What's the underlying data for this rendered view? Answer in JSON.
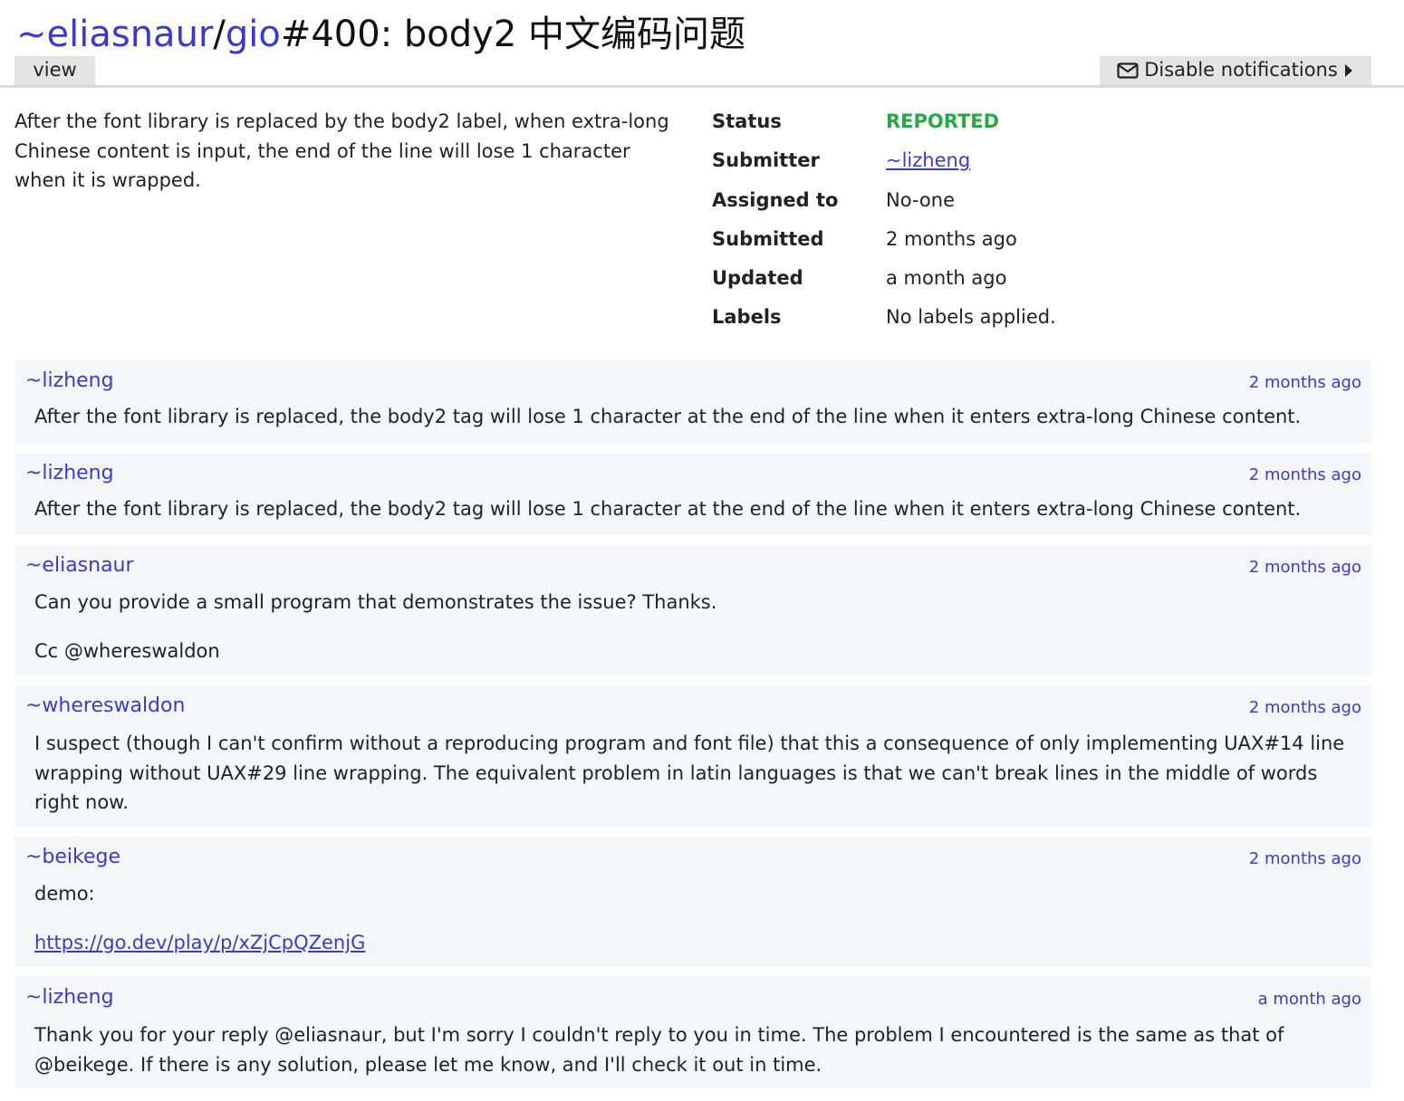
{
  "header": {
    "owner": "~eliasnaur",
    "separator": "/",
    "repo": "gio",
    "issue_title": "#400: body2 中文编码问题",
    "tab_view": "view",
    "notify_label": "Disable notifications",
    "notify_icon": "envelope-icon",
    "notify_caret": "caret-right-icon"
  },
  "summary": "After the font library is replaced by the body2 label, when extra-long Chinese content is input, the end of the line will lose 1 character when it is wrapped.",
  "meta": {
    "status_key": "Status",
    "status_val": "REPORTED",
    "status_color": "#27a844",
    "submitter_key": "Submitter",
    "submitter_val": "~lizheng",
    "assigned_key": "Assigned to",
    "assigned_val": "No-one",
    "submitted_key": "Submitted",
    "submitted_val": "2 months ago",
    "updated_key": "Updated",
    "updated_val": "a month ago",
    "labels_key": "Labels",
    "labels_val": "No labels applied."
  },
  "comments": [
    {
      "author": "~lizheng",
      "time": "2 months ago",
      "text": "After the font library is replaced, the body2 tag will lose 1 character at the end of the line when it enters extra-long Chinese content."
    },
    {
      "author": "~lizheng",
      "time": "2 months ago",
      "text": "After the font library is replaced, the body2 tag will lose 1 character at the end of the line when it enters extra-long Chinese content."
    },
    {
      "author": "~eliasnaur",
      "time": "2 months ago",
      "text": "Can you provide a small program that demonstrates the issue? Thanks.",
      "text2": "Cc @whereswaldon"
    },
    {
      "author": "~whereswaldon",
      "time": "2 months ago",
      "text": "I suspect (though I can't confirm without a reproducing program and font file) that this a consequence of only implementing UAX#14 line wrapping without UAX#29 line wrapping. The equivalent problem in latin languages is that we can't break lines in the middle of words right now."
    },
    {
      "author": "~beikege",
      "time": "2 months ago",
      "text": "demo:",
      "link": "https://go.dev/play/p/xZjCpQZenjG"
    },
    {
      "author": "~lizheng",
      "time": "a month ago",
      "text": "Thank you for your reply @eliasnaur, but I'm sorry I couldn't reply to you in time. The problem I encountered is the same as that of @beikege. If there is any solution, please let me know, and I'll check it out in time."
    }
  ]
}
